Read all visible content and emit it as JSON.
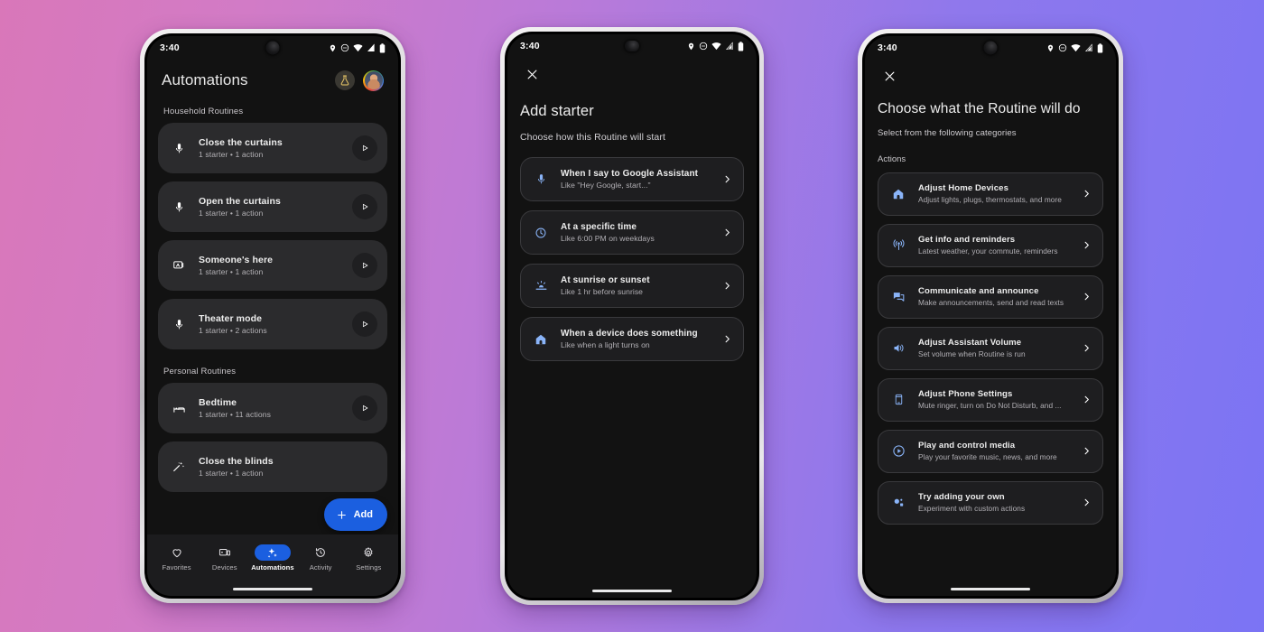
{
  "theme": {
    "bg_gradient_start": "#d977b9",
    "bg_gradient_end": "#7b74f4",
    "accent_blue": "#1b5fe0",
    "icon_blue": "#8ab4f8",
    "screen_bg": "#121212",
    "card_bg": "#2b2b2d"
  },
  "phone1": {
    "status": {
      "time": "3:40"
    },
    "header": {
      "title": "Automations",
      "flask_icon": "flask-icon",
      "avatar": "avatar"
    },
    "sections": [
      {
        "label": "Household Routines",
        "routines": [
          {
            "icon": "microphone-icon",
            "title": "Close the curtains",
            "subtitle": "1 starter • 1 action"
          },
          {
            "icon": "microphone-icon",
            "title": "Open the curtains",
            "subtitle": "1 starter • 1 action"
          },
          {
            "icon": "presence-sensor-icon",
            "title": "Someone's here",
            "subtitle": "1 starter • 1 action"
          },
          {
            "icon": "microphone-icon",
            "title": "Theater mode",
            "subtitle": "1 starter • 2 actions"
          }
        ]
      },
      {
        "label": "Personal Routines",
        "routines": [
          {
            "icon": "bed-icon",
            "title": "Bedtime",
            "subtitle": "1 starter • 11 actions"
          },
          {
            "icon": "magic-wand-icon",
            "title": "Close the blinds",
            "subtitle": "1 starter • 1 action"
          }
        ]
      }
    ],
    "fab": {
      "label": "Add",
      "icon": "plus-icon"
    },
    "bottom_nav": [
      {
        "label": "Favorites",
        "icon": "heart-icon",
        "active": false
      },
      {
        "label": "Devices",
        "icon": "devices-icon",
        "active": false
      },
      {
        "label": "Automations",
        "icon": "sparkle-icon",
        "active": true
      },
      {
        "label": "Activity",
        "icon": "history-icon",
        "active": false
      },
      {
        "label": "Settings",
        "icon": "gear-icon",
        "active": false
      }
    ]
  },
  "phone2": {
    "status": {
      "time": "3:40"
    },
    "close_icon": "close-icon",
    "title": "Add starter",
    "subtitle": "Choose how this Routine will start",
    "options": [
      {
        "icon": "microphone-icon",
        "title": "When I say to Google Assistant",
        "subtitle": "Like \"Hey Google, start...\""
      },
      {
        "icon": "clock-icon",
        "title": "At a specific time",
        "subtitle": "Like 6:00 PM on weekdays"
      },
      {
        "icon": "sunrise-icon",
        "title": "At sunrise or sunset",
        "subtitle": "Like 1 hr before sunrise"
      },
      {
        "icon": "home-icon",
        "title": "When a device does something",
        "subtitle": "Like when a light turns on"
      }
    ]
  },
  "phone3": {
    "status": {
      "time": "3:40"
    },
    "close_icon": "close-icon",
    "title": "Choose what the Routine will do",
    "subtitle": "Select from the following categories",
    "section_label": "Actions",
    "options": [
      {
        "icon": "home-icon",
        "title": "Adjust Home Devices",
        "subtitle": "Adjust lights, plugs, thermostats, and more"
      },
      {
        "icon": "broadcast-icon",
        "title": "Get info and reminders",
        "subtitle": "Latest weather, your commute, reminders"
      },
      {
        "icon": "chat-icon",
        "title": "Communicate and announce",
        "subtitle": "Make announcements, send and read texts"
      },
      {
        "icon": "volume-icon",
        "title": "Adjust Assistant Volume",
        "subtitle": "Set volume when Routine is run"
      },
      {
        "icon": "phone-icon",
        "title": "Adjust Phone Settings",
        "subtitle": "Mute ringer, turn on Do Not Disturb, and ..."
      },
      {
        "icon": "play-circle-icon",
        "title": "Play and control media",
        "subtitle": "Play your favorite music, news, and more"
      },
      {
        "icon": "custom-action-icon",
        "title": "Try adding your own",
        "subtitle": "Experiment with custom actions"
      }
    ]
  }
}
